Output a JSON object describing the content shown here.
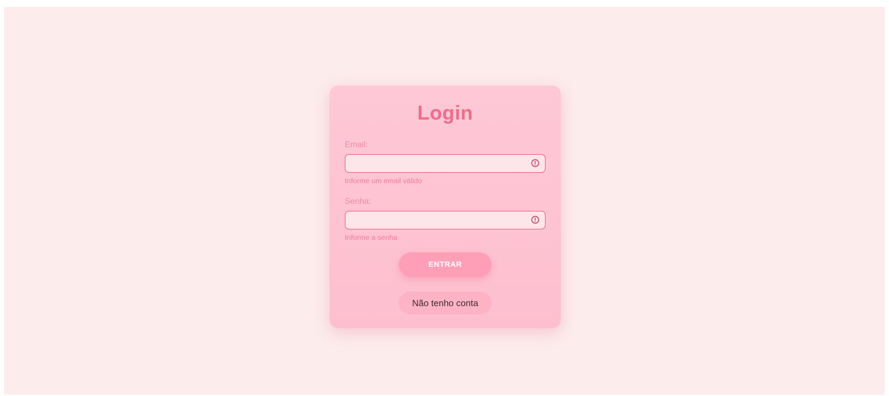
{
  "login": {
    "title": "Login",
    "email": {
      "label": "Email:",
      "value": "",
      "placeholder": "",
      "error": "Informe um email válido"
    },
    "password": {
      "label": "Senha:",
      "value": "",
      "placeholder": "",
      "error": "Informe a senha"
    },
    "submit_label": "ENTRAR",
    "no_account_label": "Não tenho conta"
  },
  "icons": {
    "email_alert": "alert-circle-icon",
    "password_alert": "alert-circle-icon"
  },
  "colors": {
    "page_background": "#fcecec",
    "card_background": "#fec8d6",
    "title": "#ef6d8c",
    "error": "#ee6d89",
    "primary_button": "#fe9fb7",
    "secondary_button": "#fdb3c3"
  }
}
